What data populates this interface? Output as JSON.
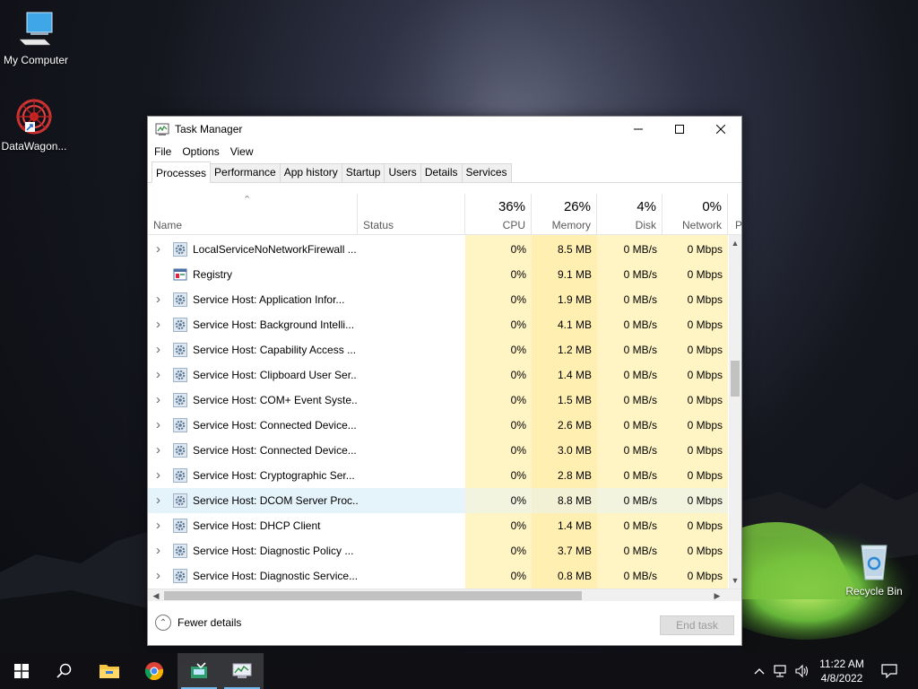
{
  "desktop": {
    "icons": [
      {
        "label": "My Computer"
      },
      {
        "label": "DataWagon..."
      },
      {
        "label": "Recycle Bin"
      }
    ]
  },
  "window": {
    "title": "Task Manager",
    "menu": [
      "File",
      "Options",
      "View"
    ],
    "tabs": [
      "Processes",
      "Performance",
      "App history",
      "Startup",
      "Users",
      "Details",
      "Services"
    ],
    "active_tab": "Processes",
    "columns": {
      "name": "Name",
      "status": "Status",
      "cpu": {
        "pct": "36%",
        "label": "CPU"
      },
      "memory": {
        "pct": "26%",
        "label": "Memory"
      },
      "disk": {
        "pct": "4%",
        "label": "Disk"
      },
      "network": {
        "pct": "0%",
        "label": "Network"
      },
      "power": {
        "label": "P"
      }
    },
    "rows": [
      {
        "name": "LocalServiceNoNetworkFirewall ...",
        "cpu": "0%",
        "memory": "8.5 MB",
        "disk": "0 MB/s",
        "network": "0 Mbps",
        "expandable": true,
        "icon": "gear-icon"
      },
      {
        "name": "Registry",
        "cpu": "0%",
        "memory": "9.1 MB",
        "disk": "0 MB/s",
        "network": "0 Mbps",
        "expandable": false,
        "icon": "registry-icon"
      },
      {
        "name": "Service Host: Application Infor...",
        "cpu": "0%",
        "memory": "1.9 MB",
        "disk": "0 MB/s",
        "network": "0 Mbps",
        "expandable": true,
        "icon": "gear-icon"
      },
      {
        "name": "Service Host: Background Intelli...",
        "cpu": "0%",
        "memory": "4.1 MB",
        "disk": "0 MB/s",
        "network": "0 Mbps",
        "expandable": true,
        "icon": "gear-icon"
      },
      {
        "name": "Service Host: Capability Access ...",
        "cpu": "0%",
        "memory": "1.2 MB",
        "disk": "0 MB/s",
        "network": "0 Mbps",
        "expandable": true,
        "icon": "gear-icon"
      },
      {
        "name": "Service Host: Clipboard User Ser...",
        "cpu": "0%",
        "memory": "1.4 MB",
        "disk": "0 MB/s",
        "network": "0 Mbps",
        "expandable": true,
        "icon": "gear-icon"
      },
      {
        "name": "Service Host: COM+ Event Syste...",
        "cpu": "0%",
        "memory": "1.5 MB",
        "disk": "0 MB/s",
        "network": "0 Mbps",
        "expandable": true,
        "icon": "gear-icon"
      },
      {
        "name": "Service Host: Connected Device...",
        "cpu": "0%",
        "memory": "2.6 MB",
        "disk": "0 MB/s",
        "network": "0 Mbps",
        "expandable": true,
        "icon": "gear-icon"
      },
      {
        "name": "Service Host: Connected Device...",
        "cpu": "0%",
        "memory": "3.0 MB",
        "disk": "0 MB/s",
        "network": "0 Mbps",
        "expandable": true,
        "icon": "gear-icon"
      },
      {
        "name": "Service Host: Cryptographic Ser...",
        "cpu": "0%",
        "memory": "2.8 MB",
        "disk": "0 MB/s",
        "network": "0 Mbps",
        "expandable": true,
        "icon": "gear-icon"
      },
      {
        "name": "Service Host: DCOM Server Proc...",
        "cpu": "0%",
        "memory": "8.8 MB",
        "disk": "0 MB/s",
        "network": "0 Mbps",
        "expandable": true,
        "icon": "gear-icon",
        "selected": true
      },
      {
        "name": "Service Host: DHCP Client",
        "cpu": "0%",
        "memory": "1.4 MB",
        "disk": "0 MB/s",
        "network": "0 Mbps",
        "expandable": true,
        "icon": "gear-icon"
      },
      {
        "name": "Service Host: Diagnostic Policy ...",
        "cpu": "0%",
        "memory": "3.7 MB",
        "disk": "0 MB/s",
        "network": "0 Mbps",
        "expandable": true,
        "icon": "gear-icon"
      },
      {
        "name": "Service Host: Diagnostic Service...",
        "cpu": "0%",
        "memory": "0.8 MB",
        "disk": "0 MB/s",
        "network": "0 Mbps",
        "expandable": true,
        "icon": "gear-icon"
      }
    ],
    "footer": {
      "fewer_details": "Fewer details",
      "end_task": "End task"
    }
  },
  "taskbar": {
    "apps": [
      "start-icon",
      "search-icon",
      "file-explorer-icon",
      "chrome-icon",
      "app-icon",
      "task-manager-icon"
    ],
    "clock": {
      "time": "11:22 AM",
      "date": "4/8/2022"
    }
  },
  "colors": {
    "cpu_col": "#fff4c4",
    "mem_col": "#ffefb0",
    "selected_row": "#e5f3fb",
    "accent": "#76b9ed"
  }
}
